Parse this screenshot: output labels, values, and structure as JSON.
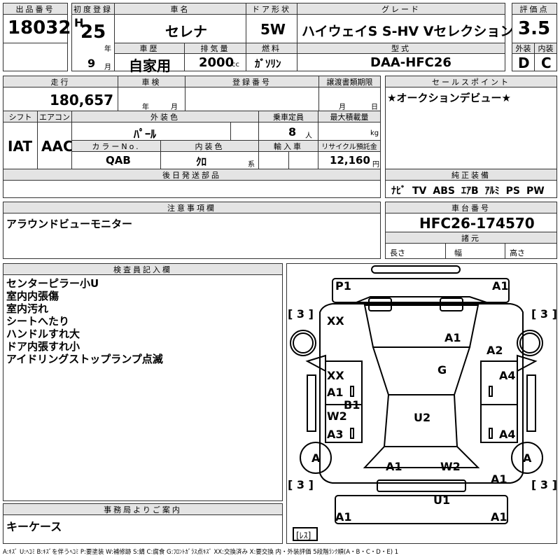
{
  "header": {
    "lot_no_label": "出品番号",
    "lot_no": "18032",
    "first_reg_label": "初度登録",
    "era": "H",
    "year": "25",
    "year_unit": "年",
    "month": "9",
    "month_unit": "月",
    "name_label": "車名",
    "name": "セレナ",
    "door_label": "ドア形状",
    "door": "5W",
    "grade_label": "グレード",
    "grade": "ハイウェイS S-HV Vセレクション",
    "score_label": "評価点",
    "score": "3.5",
    "history_label": "車歴",
    "history": "自家用",
    "displacement_label": "排気量",
    "displacement": "2000",
    "displacement_unit": "cc",
    "fuel_label": "燃料",
    "fuel": "ｶﾞｿﾘﾝ",
    "model_label": "型式",
    "model": "DAA-HFC26",
    "ext_label": "外装",
    "ext_grade": "D",
    "int_label": "内装",
    "int_grade": "C"
  },
  "row2": {
    "mileage_label": "走行",
    "mileage": "180,657 km",
    "inspection_label": "車検",
    "year_unit": "年",
    "month_unit": "月",
    "regno_label": "登録番号",
    "transfer_label": "譲渡書類期限",
    "day_unit": "日",
    "sales_label": "セールスポイント",
    "sales_text": "★オークションデビュー★"
  },
  "row3": {
    "shift_label": "シフト",
    "shift": "IAT",
    "ac_label": "エアコン",
    "ac": "AAC",
    "color_label": "外装色",
    "color": "ﾊﾟｰﾙ",
    "capacity_label": "乗車定員",
    "capacity": "8",
    "capacity_unit": "人",
    "load_label": "最大積載量",
    "load_unit": "kg",
    "colorno_label": "カラーNo.",
    "colorno": "QAB",
    "intcolor_label": "内装色",
    "intcolor": "ｸﾛ",
    "intcolor_suffix": "系",
    "import_label": "輸入車",
    "recycle_label": "リサイクル預託金",
    "recycle": "12,160",
    "recycle_unit": "円"
  },
  "later_parts_label": "後日発送部品",
  "equipment": {
    "label": "純正装備",
    "items": [
      "ﾅﾋﾞ",
      "TV",
      "ABS",
      "ｴｱB",
      "ｱﾙﾐ",
      "PS",
      "PW"
    ]
  },
  "notes": {
    "label": "注意事項欄",
    "text": "アラウンドビューモニター"
  },
  "chassis": {
    "label": "車台番号",
    "number": "HFC26-174570",
    "dims_label": "諸元",
    "length_label": "長さ",
    "width_label": "幅",
    "height_label": "高さ"
  },
  "inspector": {
    "label": "検査員記入欄",
    "lines": [
      "センターピラー小U",
      "室内内張傷",
      "室内汚れ",
      "シートへたり",
      "ハンドルすれ大",
      "ドア内張すれ小",
      "アイドリングストップランプ点滅"
    ]
  },
  "office": {
    "label": "事務局よりご案内",
    "text": "キーケース"
  },
  "diagram": {
    "tread_marks": [
      "[ 3 ]",
      "[ 3 ]",
      "[ 3 ]",
      "[ 3 ]"
    ],
    "tire_labels": [
      "A",
      "A"
    ],
    "spare": "[ﾚｽ]",
    "codes": {
      "p1": "P1",
      "a1_fr": "A1",
      "xx_fl": "XX",
      "a1_hood": "A1",
      "a2_fr": "A2",
      "g": "G",
      "xx_ld": "XX",
      "a4_rd": "A4",
      "a1_ld": "A1",
      "b1": "B1",
      "w2_ls": "W2",
      "u2": "U2",
      "a3_ls": "A3",
      "a4_rs": "A4",
      "a1_rear": "A1",
      "w2_rear": "W2",
      "a1_rr": "A1",
      "u1": "U1",
      "a1_bl": "A1",
      "a1_br": "A1"
    }
  },
  "legend": "A:ｷｽﾞ U:ﾍｺﾐ B:ｷｽﾞを伴うﾍｺﾐ P:要塗装 W:補修跡 S:錆 C:腐食 G:ﾌﾛﾝﾄｶﾞﾗｽ点ｷｽﾞ XX:交換済み X:要交換 内・外装評価 5段階ﾗﾝｸ順(A・B・C・D・E) 1"
}
